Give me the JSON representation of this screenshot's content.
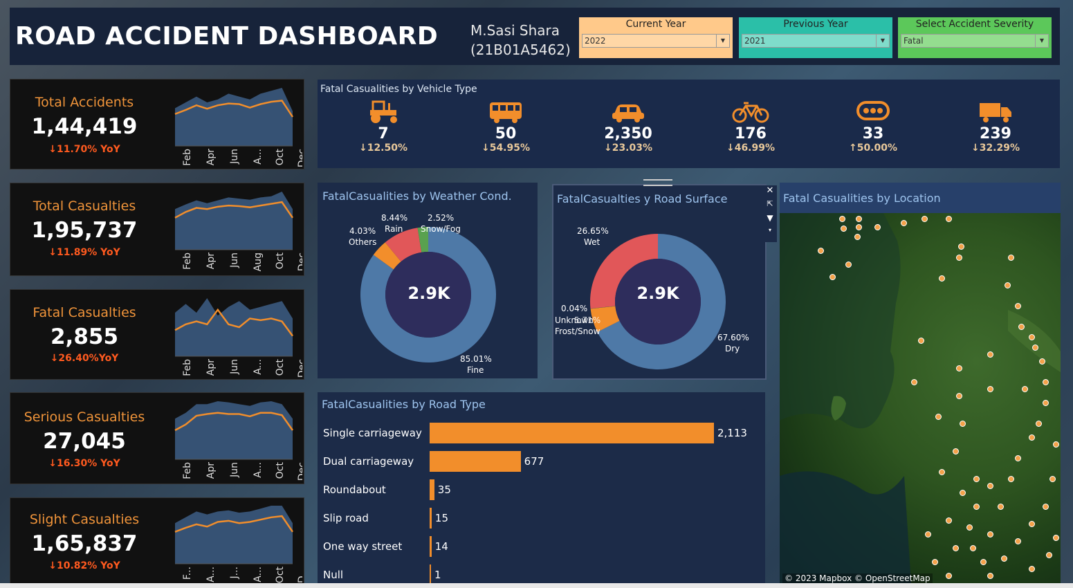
{
  "header": {
    "title": "ROAD ACCIDENT DASHBOARD",
    "author_name": "M.Sasi Shara",
    "author_id": "(21B01A5462)"
  },
  "filters": [
    {
      "label": "Current Year",
      "value": "2022",
      "color": "#ffc98a"
    },
    {
      "label": "Previous Year",
      "value": "2021",
      "color": "#2bbfa8"
    },
    {
      "label": "Select Accident Severity",
      "value": "Fatal",
      "color": "#5cc85a"
    }
  ],
  "kpis": [
    {
      "title": "Total Accidents",
      "value": "1,44,419",
      "yoy": "↓11.70% YoY",
      "ticks": [
        "Feb",
        "Apr",
        "Jun",
        "A...",
        "Oct",
        "Dec"
      ]
    },
    {
      "title": "Total Casualties",
      "value": "1,95,737",
      "yoy": "↓11.89% YoY",
      "ticks": [
        "Feb",
        "Apr",
        "Jun",
        "Aug",
        "Oct",
        "Dec"
      ]
    },
    {
      "title": "Fatal Casualties",
      "value": "2,855",
      "yoy": "↓26.40%YoY",
      "ticks": [
        "Feb",
        "Apr",
        "Jun",
        "A...",
        "Oct",
        "Dec"
      ]
    },
    {
      "title": "Serious Casualties",
      "value": "27,045",
      "yoy": "↓16.30% YoY",
      "ticks": [
        "Feb",
        "Apr",
        "Jun",
        "A...",
        "Oct",
        "Dec"
      ]
    },
    {
      "title": "Slight Casualties",
      "value": "1,65,837",
      "yoy": "↓10.82% YoY",
      "ticks": [
        "F...",
        "A...",
        "J...",
        "A...",
        "Oct",
        "D..."
      ]
    }
  ],
  "vehicle_panel": {
    "title": "Fatal Casualities by Vehicle Type",
    "items": [
      {
        "icon": "tractor-icon",
        "value": "7",
        "change": "↓12.50%"
      },
      {
        "icon": "bus-icon",
        "value": "50",
        "change": "↓54.95%"
      },
      {
        "icon": "car-icon",
        "value": "2,350",
        "change": "↓23.03%"
      },
      {
        "icon": "bicycle-icon",
        "value": "176",
        "change": "↓46.99%"
      },
      {
        "icon": "other-vehicle-icon",
        "value": "33",
        "change": "↑50.00%"
      },
      {
        "icon": "truck-icon",
        "value": "239",
        "change": "↓32.29%"
      }
    ]
  },
  "weather_panel": {
    "title": "FatalCasualities by Weather Cond.",
    "center": "2.9K",
    "labels": {
      "rain_pct": "8.44%",
      "rain": "Rain",
      "snow_pct": "2.52%",
      "snow": "Snow/Fog",
      "others_pct": "4.03%",
      "others": "Others",
      "fine_pct": "85.01%",
      "fine": "Fine"
    }
  },
  "surface_panel": {
    "title": "FatalCasualties y Road Surface",
    "center": "2.9K",
    "labels": {
      "wet_pct": "26.65%",
      "wet": "Wet",
      "unk_pct": "0.04%",
      "unk": "Unknown",
      "frost_pct": "5.71%",
      "frost": "Frost/Snow",
      "dry_pct": "67.60%",
      "dry": "Dry"
    }
  },
  "map_panel": {
    "title": "Fatal Casualities  by Location",
    "attribution": "© 2023 Mapbox © OpenStreetMap"
  },
  "chart_data": [
    {
      "type": "pie",
      "title": "FatalCasualities by Weather Cond.",
      "categories": [
        "Fine",
        "Others",
        "Rain",
        "Snow/Fog"
      ],
      "values": [
        85.01,
        4.03,
        8.44,
        2.52
      ],
      "colors": [
        "#4e79a7",
        "#f28e2b",
        "#e15759",
        "#59a14f"
      ]
    },
    {
      "type": "pie",
      "title": "FatalCasualties y Road Surface",
      "categories": [
        "Dry",
        "Frost/Snow",
        "Unknown",
        "Wet"
      ],
      "values": [
        67.6,
        5.71,
        0.04,
        26.65
      ],
      "colors": [
        "#4e79a7",
        "#f28e2b",
        "#59a14f",
        "#e15759"
      ]
    },
    {
      "type": "bar",
      "title": "FatalCasualities by Road Type",
      "categories": [
        "Single carriageway",
        "Dual carriageway",
        "Roundabout",
        "Slip road",
        "One way street",
        "Null"
      ],
      "values": [
        2113,
        677,
        35,
        15,
        14,
        1
      ],
      "value_labels": [
        "2,113",
        "677",
        "35",
        "15",
        "14",
        "1"
      ]
    }
  ]
}
